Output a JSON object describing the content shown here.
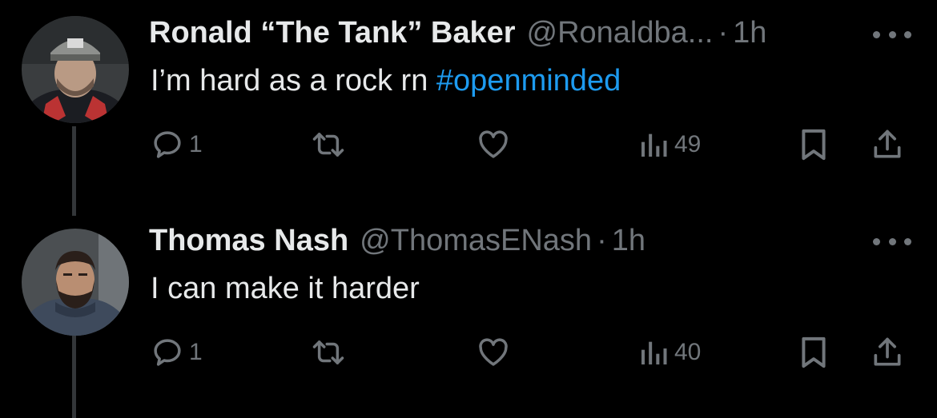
{
  "tweets": [
    {
      "name": "Ronald “The Tank” Baker",
      "handle": "@Ronaldba...",
      "separator": "·",
      "time": "1h",
      "text_plain": "I’m hard as a rock rn ",
      "hashtag": "#openminded",
      "replies": "1",
      "views": "49"
    },
    {
      "name": "Thomas Nash",
      "handle": "@ThomasENash",
      "separator": "·",
      "time": "1h",
      "text_plain": "I can make it harder",
      "hashtag": "",
      "replies": "1",
      "views": "40"
    }
  ],
  "icons": {
    "reply": "reply-icon",
    "retweet": "retweet-icon",
    "like": "heart-icon",
    "views": "analytics-icon",
    "bookmark": "bookmark-icon",
    "share": "share-icon",
    "more": "more-dots-icon"
  },
  "colors": {
    "background": "#000000",
    "text": "#e7e9ea",
    "muted": "#71767b",
    "link": "#1d9bf0",
    "thread_line": "#333639"
  }
}
